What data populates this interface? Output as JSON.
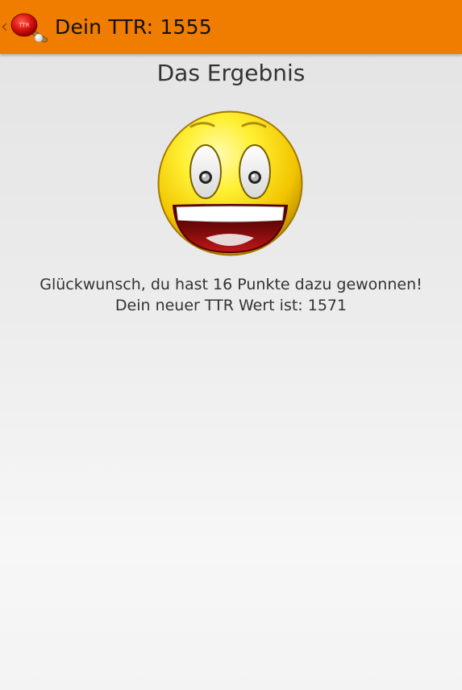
{
  "actionbar": {
    "title": "Dein TTR: 1555",
    "icon_name": "ping-pong-paddle-icon",
    "up_icon_name": "chevron-left-icon",
    "background_color": "#f07c00"
  },
  "main": {
    "heading": "Das Ergebnis",
    "image_name": "happy-smiley-icon",
    "message_line1": "Glückwunsch, du hast 16 Punkte dazu gewonnen!",
    "message_line2": "Dein neuer TTR Wert ist: 1571"
  }
}
